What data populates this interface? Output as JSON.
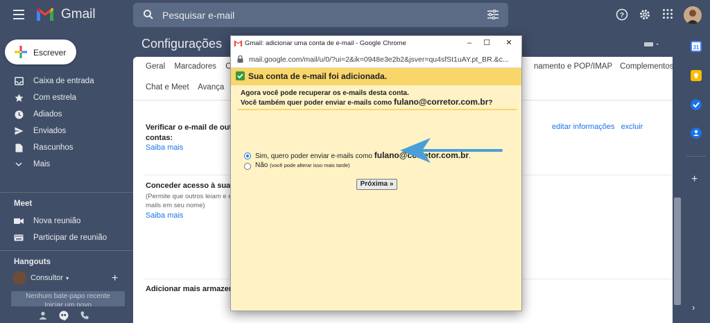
{
  "app": {
    "name": "Gmail"
  },
  "search": {
    "placeholder": "Pesquisar e-mail"
  },
  "compose": {
    "label": "Escrever"
  },
  "sidebar": {
    "items": [
      {
        "label": "Caixa de entrada",
        "icon": "inbox-icon"
      },
      {
        "label": "Com estrela",
        "icon": "star-icon"
      },
      {
        "label": "Adiados",
        "icon": "clock-icon"
      },
      {
        "label": "Enviados",
        "icon": "send-icon"
      },
      {
        "label": "Rascunhos",
        "icon": "draft-icon"
      },
      {
        "label": "Mais",
        "icon": "chevron-down-icon"
      }
    ],
    "meet": {
      "title": "Meet",
      "items": [
        {
          "label": "Nova reunião",
          "icon": "video-icon"
        },
        {
          "label": "Participar de reunião",
          "icon": "keyboard-icon"
        }
      ]
    },
    "hangouts": {
      "title": "Hangouts",
      "user": "Consultor",
      "empty_line1": "Nenhum bate-papo recente",
      "empty_line2": "Iniciar um novo"
    }
  },
  "main": {
    "title": "Configurações",
    "tabs_row1": [
      "Geral",
      "Marcadores",
      "Ca"
    ],
    "tabs_row1_right": [
      "namento e POP/IMAP",
      "Complementos"
    ],
    "tabs_row2": [
      "Chat e Meet",
      "Avança"
    ],
    "sections": [
      {
        "label_line1": "Verificar o e-mail de outr",
        "label_line2": "contas:",
        "link": "Saiba mais"
      },
      {
        "label_line1": "Conceder acesso à sua c",
        "sub_line1": "(Permite que outros leiam e e",
        "sub_line2": "mails em seu nome)",
        "link": "Saiba mais"
      },
      {
        "label_line1": "Adicionar mais armazena"
      }
    ],
    "right_links": {
      "edit": "editar informações",
      "delete": "excluir"
    }
  },
  "popup": {
    "window_title": "Gmail: adicionar uma conta de e-mail - Google Chrome",
    "url": "mail.google.com/mail/u/0/?ui=2&ik=0948e3e2b2&jsver=qu4sfSt1uAY.pt_BR.&c...",
    "header": "Sua conta de e-mail foi adicionada.",
    "line1": "Agora você pode recuperar os e-mails desta conta.",
    "line2_prefix": "Você também quer poder enviar e-mails como ",
    "email": "fulano@corretor.com.br",
    "line2_suffix": "?",
    "option_yes_prefix": "Sim, quero poder enviar e-mails como ",
    "option_yes_suffix": ".",
    "option_no": "Não",
    "option_no_hint": "(você pode alterar isso mais tarde)",
    "selected_option": "yes",
    "next_button": "Próxima »"
  },
  "colors": {
    "background": "#404e68",
    "popup_header": "#f9d66a",
    "popup_body": "#fff2c4",
    "arrow": "#4a9fd8",
    "link": "#1a73e8"
  }
}
